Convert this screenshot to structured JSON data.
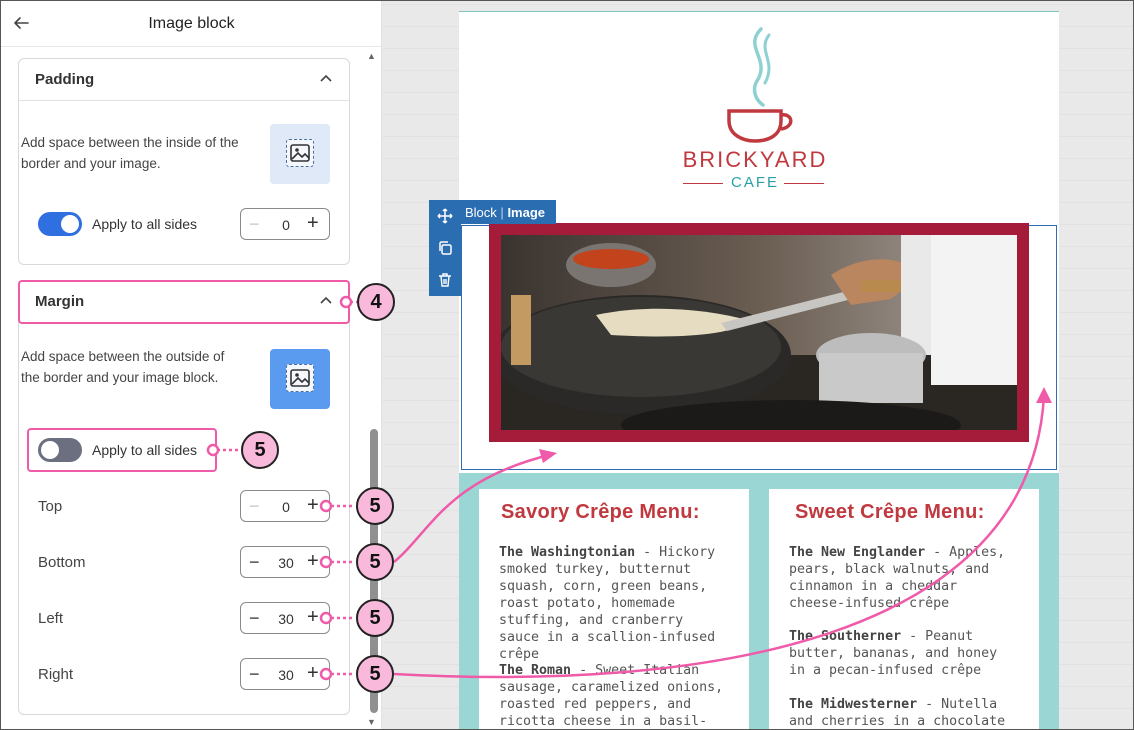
{
  "panel": {
    "title": "Image block",
    "padding": {
      "title": "Padding",
      "description": "Add space between the inside of the border and your image.",
      "toggle_label": "Apply to all sides",
      "toggle_on": true,
      "value": "0"
    },
    "margin": {
      "title": "Margin",
      "description": "Add space between the outside of the border and your image block.",
      "toggle_label": "Apply to all sides",
      "toggle_on": false,
      "sides": [
        {
          "label": "Top",
          "value": "0"
        },
        {
          "label": "Bottom",
          "value": "30"
        },
        {
          "label": "Left",
          "value": "30"
        },
        {
          "label": "Right",
          "value": "30"
        }
      ]
    }
  },
  "canvas": {
    "block_label_prefix": "Block",
    "block_label_sep": "|",
    "block_label_type": "Image",
    "brand_top": "BRICKYARD",
    "brand_bottom": "CAFE",
    "menus": [
      {
        "title": "Savory Crêpe Menu:",
        "items": [
          {
            "name": "The Washingtonian",
            "text": " - Hickory smoked turkey, butternut squash, corn, green beans, roast potato, homemade stuffing, and cranberry sauce in a scallion-infused crêpe"
          },
          {
            "name": "The Roman",
            "text": " - Sweet Italian sausage, caramelized onions, roasted red peppers, and ricotta cheese in a basil-infused crêpe"
          }
        ]
      },
      {
        "title": "Sweet Crêpe Menu:",
        "items": [
          {
            "name": "The New Englander",
            "text": " - Apples, pears, black walnuts, and cinnamon in a cheddar cheese-infused crêpe"
          },
          {
            "name": "The Southerner",
            "text": " - Peanut butter, bananas, and honey in a pecan-infused crêpe"
          },
          {
            "name": "The Midwesterner",
            "text": " - Nutella and cherries in a chocolate chip-"
          }
        ]
      }
    ]
  },
  "callouts": [
    "4",
    "5",
    "5",
    "5",
    "5",
    "5"
  ],
  "colors": {
    "accent": "#2f6fe0",
    "callout_fill": "#f9b9da",
    "callout_line": "#ef5aa9",
    "brand_red": "#c0393f",
    "brand_teal": "#27a1a7",
    "frame_red": "#a51c3a",
    "menu_bg": "#99d6d4"
  },
  "icons": [
    "back-arrow-icon",
    "chevron-up-icon",
    "image-icon",
    "move-icon",
    "duplicate-icon",
    "trash-icon",
    "coffee-cup-logo"
  ]
}
